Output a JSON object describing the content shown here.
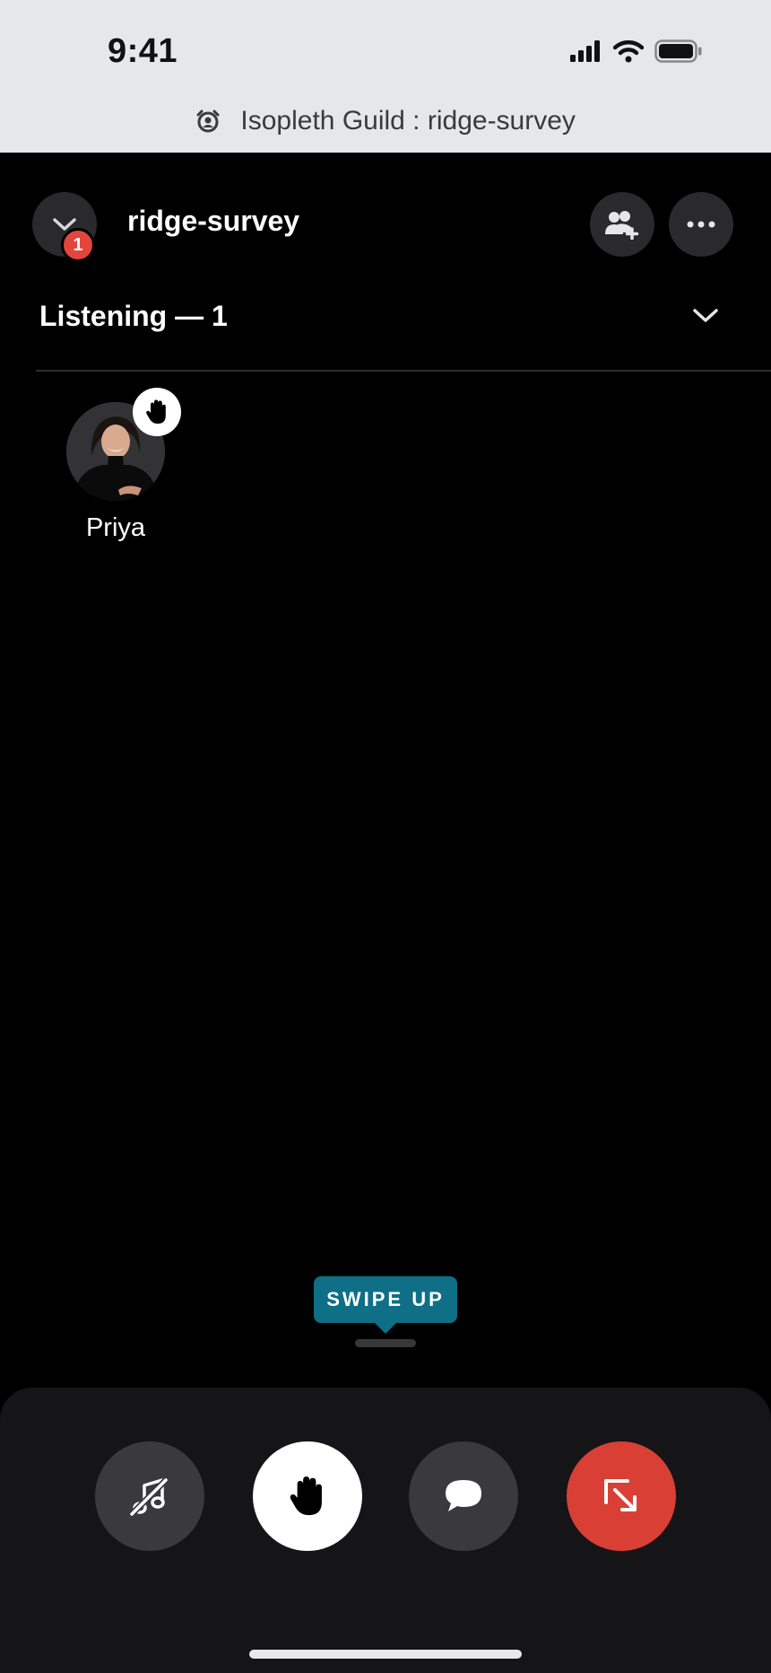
{
  "status_bar": {
    "time": "9:41"
  },
  "browser": {
    "url_text": "Isopleth Guild : ridge-survey",
    "icon": "alarm-clock-icon"
  },
  "header": {
    "collapse_icon": "chevron-down-icon",
    "notification_count": "1",
    "channel_name": "ridge-survey",
    "invite_icon": "add-people-icon",
    "more_icon": "more-horizontal-icon"
  },
  "section": {
    "label": "Listening — 1",
    "toggle_icon": "chevron-down-icon"
  },
  "participants": [
    {
      "name": "Priya",
      "status_icon": "raised-hand-icon"
    }
  ],
  "tooltip": {
    "text": "SWIPE UP"
  },
  "actions": [
    {
      "name": "soundboard",
      "icon": "music-note-icon",
      "color": "#3a3a3c"
    },
    {
      "name": "raise-hand",
      "icon": "hand-icon",
      "color": "#ffffff"
    },
    {
      "name": "chat",
      "icon": "chat-bubble-icon",
      "color": "#3a3a3c"
    },
    {
      "name": "leave",
      "icon": "leave-arrow-icon",
      "color": "#d93f35"
    }
  ],
  "colors": {
    "accent_tooltip": "#0e6f86",
    "danger": "#d93f35",
    "badge": "#e2453c"
  }
}
